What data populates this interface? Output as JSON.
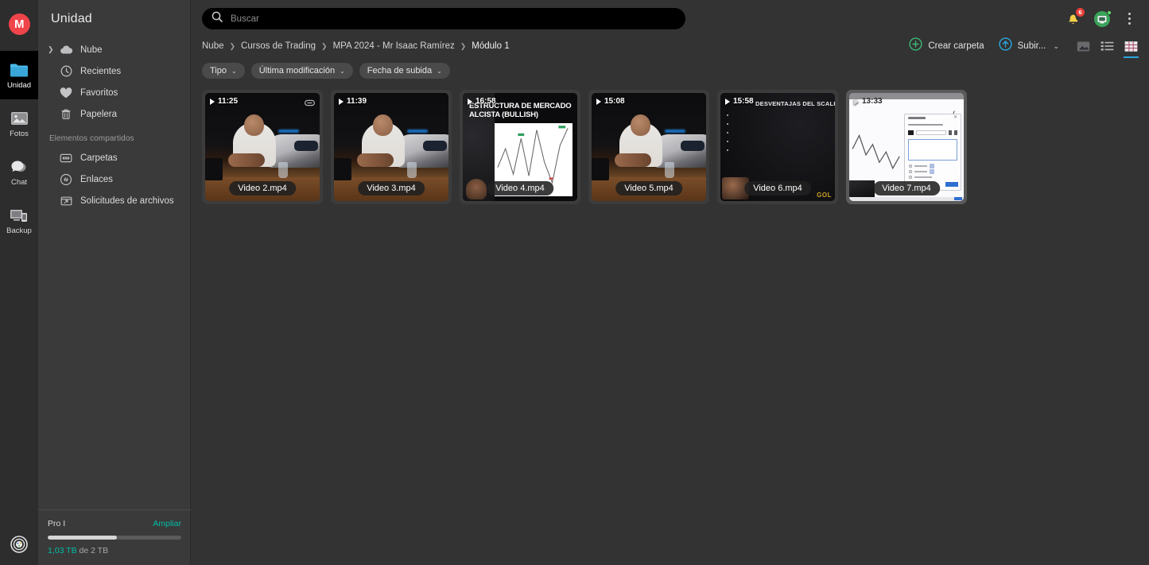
{
  "rail": {
    "avatar_initial": "M",
    "avatar_color": "#f0444b",
    "items": [
      {
        "label": "Unidad",
        "icon": "folder-icon",
        "active": true
      },
      {
        "label": "Fotos",
        "icon": "photos-icon",
        "active": false
      },
      {
        "label": "Chat",
        "icon": "chat-icon",
        "active": false
      },
      {
        "label": "Backup",
        "icon": "backup-icon",
        "active": false
      }
    ],
    "bottom_icon": "settings-icon"
  },
  "sidebar": {
    "title": "Unidad",
    "items": [
      {
        "label": "Nube",
        "icon": "cloud-icon",
        "has_caret": true
      },
      {
        "label": "Recientes",
        "icon": "clock-icon",
        "has_caret": false
      },
      {
        "label": "Favoritos",
        "icon": "heart-icon",
        "has_caret": false
      },
      {
        "label": "Papelera",
        "icon": "trash-icon",
        "has_caret": false
      }
    ],
    "shared_section_label": "Elementos compartidos",
    "shared_items": [
      {
        "label": "Carpetas",
        "icon": "shared-folders-icon"
      },
      {
        "label": "Enlaces",
        "icon": "link-icon"
      },
      {
        "label": "Solicitudes de archivos",
        "icon": "file-request-icon"
      }
    ],
    "storage": {
      "plan": "Pro I",
      "upgrade_label": "Ampliar",
      "used_label": "1,03 TB",
      "total_label": " de 2 TB",
      "percent": 51.5,
      "accent_color": "#00bfa5"
    }
  },
  "topbar": {
    "search_placeholder": "Buscar",
    "search_value": "",
    "notifications_count": "6",
    "notifications_icon": "bell-icon",
    "chatbot_icon": "chatbot-icon",
    "overflow_icon": "kebab-menu-icon"
  },
  "breadcrumb": {
    "separator": "❯",
    "items": [
      "Nube",
      "Cursos de Trading",
      "MPA 2024 - Mr Isaac Ramírez",
      "Módulo 1"
    ]
  },
  "actions": {
    "new_folder_label": "Crear carpeta",
    "new_folder_icon": "plus-circle-icon",
    "upload_label": "Subir...",
    "upload_icon": "upload-circle-icon",
    "upload_caret": "⌄",
    "views": [
      {
        "name": "media-view-icon",
        "active": false
      },
      {
        "name": "list-view-icon",
        "active": false
      },
      {
        "name": "grid-view-icon",
        "active": true
      }
    ],
    "active_view_color": "#2ba6de"
  },
  "filters": [
    {
      "label": "Tipo",
      "caret": "⌄"
    },
    {
      "label": "Última modificación",
      "caret": "⌄"
    },
    {
      "label": "Fecha de subida",
      "caret": "⌄"
    }
  ],
  "files": [
    {
      "name": "Video 2.mp4",
      "duration": "11:25",
      "scene": "studio",
      "shared_link": true,
      "selected": false
    },
    {
      "name": "Video 3.mp4",
      "duration": "11:39",
      "scene": "studio",
      "shared_link": false,
      "selected": false
    },
    {
      "name": "Video 4.mp4",
      "duration": "16:58",
      "scene": "slide",
      "shared_link": false,
      "selected": false,
      "slide_title": "ESTRUCTURA DE MERCADO ALCISTA (BULLISH)"
    },
    {
      "name": "Video 5.mp4",
      "duration": "15:08",
      "scene": "studio",
      "shared_link": false,
      "selected": false
    },
    {
      "name": "Video 6.mp4",
      "duration": "15:58",
      "scene": "bullets",
      "shared_link": false,
      "selected": false,
      "slide_title": "DESVENTAJAS DEL SCALPING",
      "watermark": "GOL"
    },
    {
      "name": "Video 7.mp4",
      "duration": "13:33",
      "scene": "app",
      "shared_link": false,
      "selected": true
    }
  ]
}
